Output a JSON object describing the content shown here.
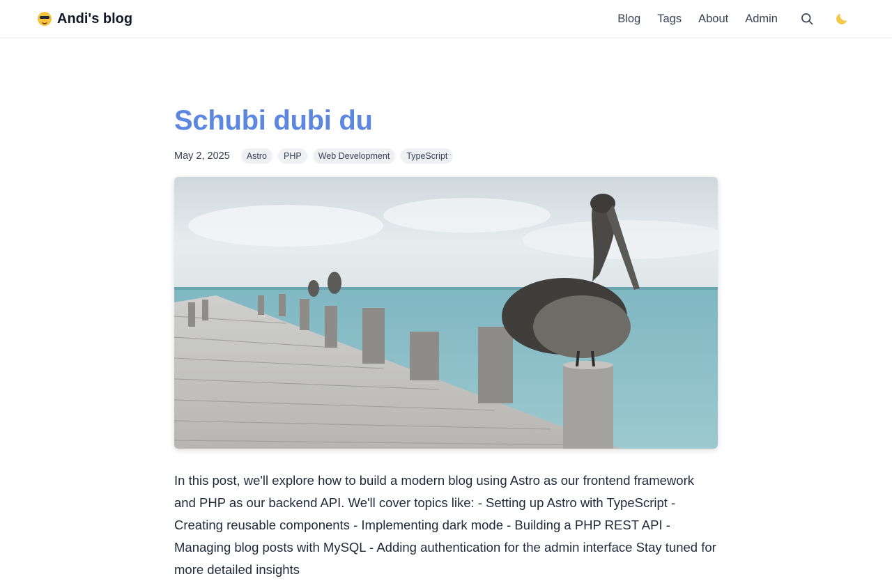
{
  "header": {
    "brand": "Andi's blog",
    "brand_icon": "sunglasses-face-emoji",
    "nav": [
      "Blog",
      "Tags",
      "About",
      "Admin"
    ],
    "search_icon": "search-icon",
    "theme_icon": "moon-icon"
  },
  "post": {
    "title": "Schubi dubi du",
    "date": "May 2, 2025",
    "tags": [
      "Astro",
      "PHP",
      "Web Development",
      "TypeScript"
    ],
    "hero_image": "pelican-on-pier-photo",
    "body": "In this post, we'll explore how to build a modern blog using Astro as our frontend framework and PHP as our backend API. We'll cover topics like: - Setting up Astro with TypeScript - Creating reusable components - Implementing dark mode - Building a PHP REST API - Managing blog posts with MySQL - Adding authentication for the admin interface Stay tuned for more detailed insights"
  },
  "colors": {
    "title": "#5b87e0",
    "tag_bg": "#eef0f4",
    "moon": "#f2c94c"
  }
}
